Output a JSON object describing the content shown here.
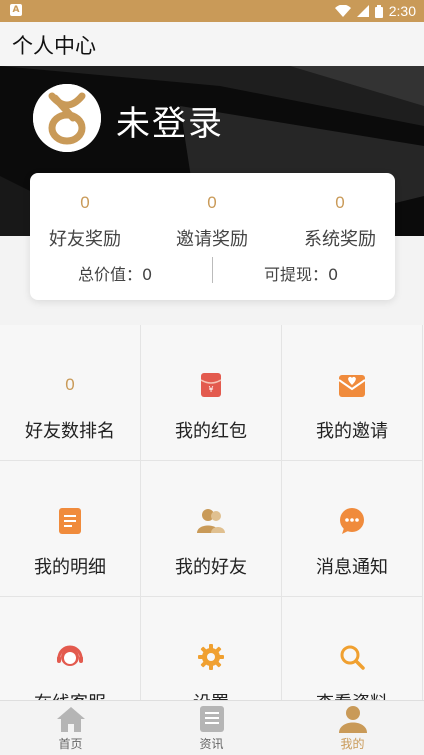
{
  "status_bar": {
    "app_icon": "A",
    "time": "2:30",
    "icons": [
      "wifi-icon",
      "signal-icon",
      "battery-icon"
    ]
  },
  "header": {
    "title": "个人中心"
  },
  "profile": {
    "username": "未登录",
    "avatar_icon": "gold-loop-logo"
  },
  "rewards": [
    {
      "value": "0",
      "label": "好友奖励"
    },
    {
      "value": "0",
      "label": "邀请奖励"
    },
    {
      "value": "0",
      "label": "系统奖励"
    }
  ],
  "totals": {
    "total_label": "总价值：0",
    "withdraw_label": "可提现：0"
  },
  "menu": [
    {
      "label": "好友数排名",
      "value": "0",
      "icon": "rank-number"
    },
    {
      "label": "我的红包",
      "icon": "red-envelope-icon"
    },
    {
      "label": "我的邀请",
      "icon": "invite-envelope-icon"
    },
    {
      "label": "我的明细",
      "icon": "document-icon"
    },
    {
      "label": "我的好友",
      "icon": "friends-icon"
    },
    {
      "label": "消息通知",
      "icon": "chat-bubble-icon"
    },
    {
      "label": "在线客服",
      "icon": "customer-service-icon"
    },
    {
      "label": "设置",
      "icon": "gear-icon"
    },
    {
      "label": "查看资料",
      "icon": "search-icon"
    }
  ],
  "tabs": [
    {
      "label": "首页",
      "icon": "home-icon"
    },
    {
      "label": "资讯",
      "icon": "news-icon"
    },
    {
      "label": "我的",
      "icon": "person-icon",
      "active": true
    }
  ],
  "colors": {
    "accent": "#c99a58",
    "red": "#e35a4e",
    "orange": "#f08b3c",
    "hero_bg": "#0b0b0b"
  }
}
